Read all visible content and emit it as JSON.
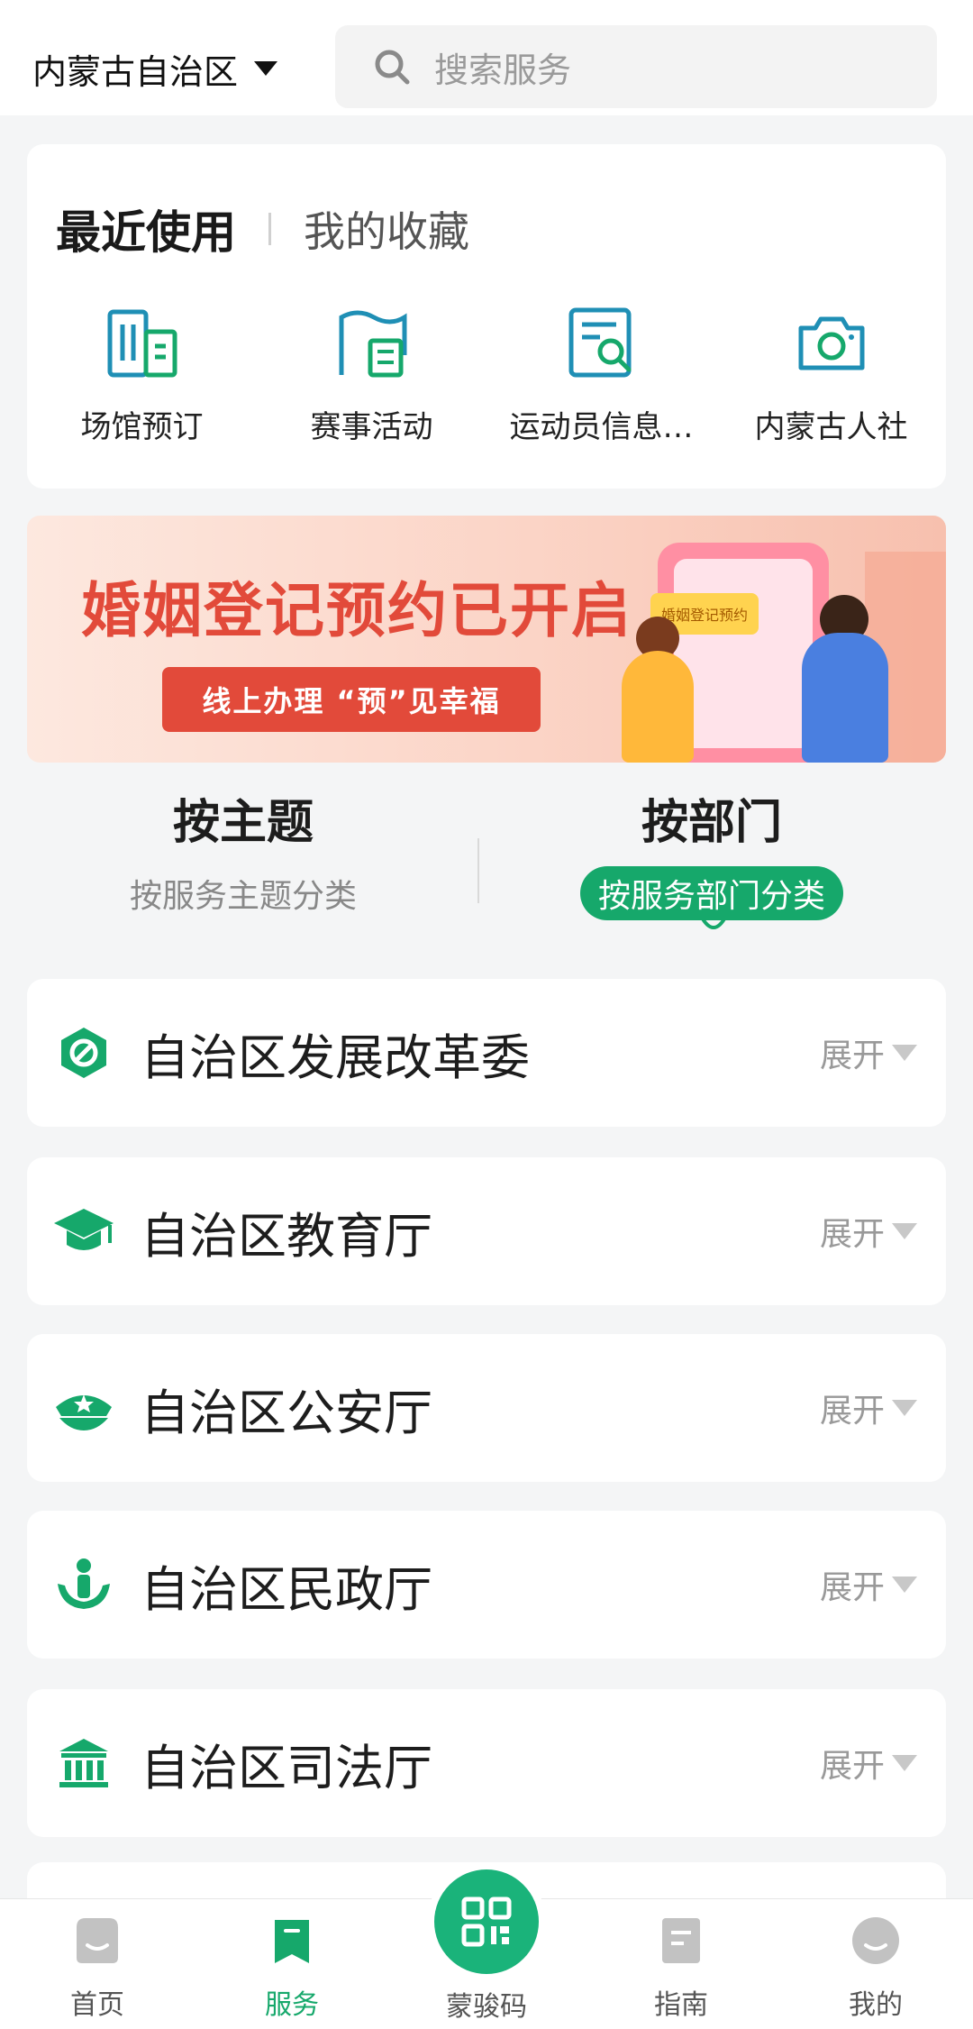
{
  "header": {
    "region": "内蒙古自治区",
    "search_placeholder": "搜索服务"
  },
  "recent": {
    "tab_active": "最近使用",
    "tab_inactive": "我的收藏",
    "items": [
      {
        "label": "场馆预订",
        "icon": "venue-building-icon"
      },
      {
        "label": "赛事活动",
        "icon": "event-flag-icon"
      },
      {
        "label": "运动员信息…",
        "icon": "athlete-search-icon"
      },
      {
        "label": "内蒙古人社",
        "icon": "camera-icon"
      }
    ]
  },
  "banner": {
    "title": "婚姻登记预约已开启",
    "subtitle": "线上办理 “预”见幸福",
    "tag": "婚姻登记预约"
  },
  "category_tabs": [
    {
      "title": "按主题",
      "subtitle": "按服务主题分类",
      "active": false
    },
    {
      "title": "按部门",
      "subtitle": "按服务部门分类",
      "active": true
    }
  ],
  "departments": [
    {
      "name": "自治区发展改革委",
      "icon": "development-reform-icon",
      "action": "展开"
    },
    {
      "name": "自治区教育厅",
      "icon": "graduation-cap-icon",
      "action": "展开"
    },
    {
      "name": "自治区公安厅",
      "icon": "police-cap-icon",
      "action": "展开"
    },
    {
      "name": "自治区民政厅",
      "icon": "civil-affairs-icon",
      "action": "展开"
    },
    {
      "name": "自治区司法厅",
      "icon": "courthouse-icon",
      "action": "展开"
    }
  ],
  "bottom_nav": [
    {
      "label": "首页",
      "icon": "home-icon",
      "active": false
    },
    {
      "label": "服务",
      "icon": "bookmark-icon",
      "active": true
    },
    {
      "label": "蒙骏码",
      "icon": "qr-code-icon",
      "active": false
    },
    {
      "label": "指南",
      "icon": "guide-icon",
      "active": false
    },
    {
      "label": "我的",
      "icon": "profile-icon",
      "active": false
    }
  ],
  "colors": {
    "accent": "#16a86b",
    "icon_blue": "#1f8fb5",
    "banner_red": "#e24a3a"
  }
}
